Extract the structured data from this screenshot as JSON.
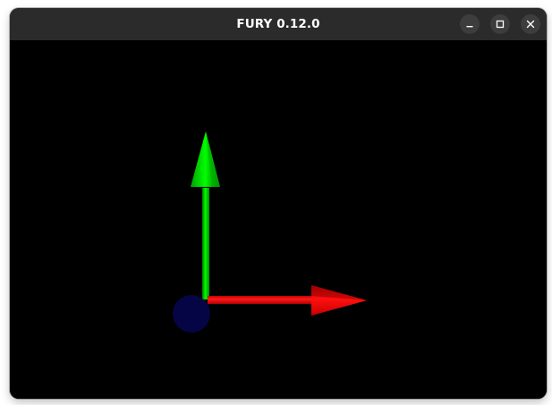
{
  "window": {
    "title": "FURY 0.12.0"
  },
  "titlebar_buttons": [
    {
      "name": "minimize",
      "icon": "minimize-icon"
    },
    {
      "name": "maximize",
      "icon": "maximize-icon"
    },
    {
      "name": "close",
      "icon": "close-icon"
    }
  ],
  "scene": {
    "background": "#000000",
    "y_axis_color": "#00e000",
    "x_axis_color": "#ff0000",
    "origin_sphere_color": "#050545"
  }
}
